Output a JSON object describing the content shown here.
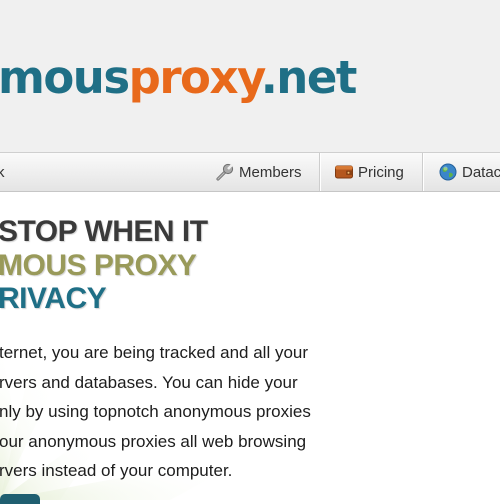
{
  "logo": {
    "part1": "mous",
    "part2": "proxy",
    "part3": ".net"
  },
  "nav": {
    "left_fragment": "k",
    "members": "Members",
    "pricing": "Pricing",
    "datacenter_fragment": "Datac"
  },
  "hero": {
    "line1": "STOP WHEN IT",
    "line2": "MOUS PROXY",
    "line3": "RIVACY",
    "body": [
      "ternet, you are being tracked and all your",
      "rvers and databases. You can hide your",
      "nly by using topnotch anonymous proxies",
      " our anonymous proxies all web browsing",
      "rvers instead of your computer."
    ]
  },
  "colors": {
    "brand_teal": "#1f6f86",
    "brand_orange": "#e8691b",
    "headline_olive": "#999a5a"
  }
}
